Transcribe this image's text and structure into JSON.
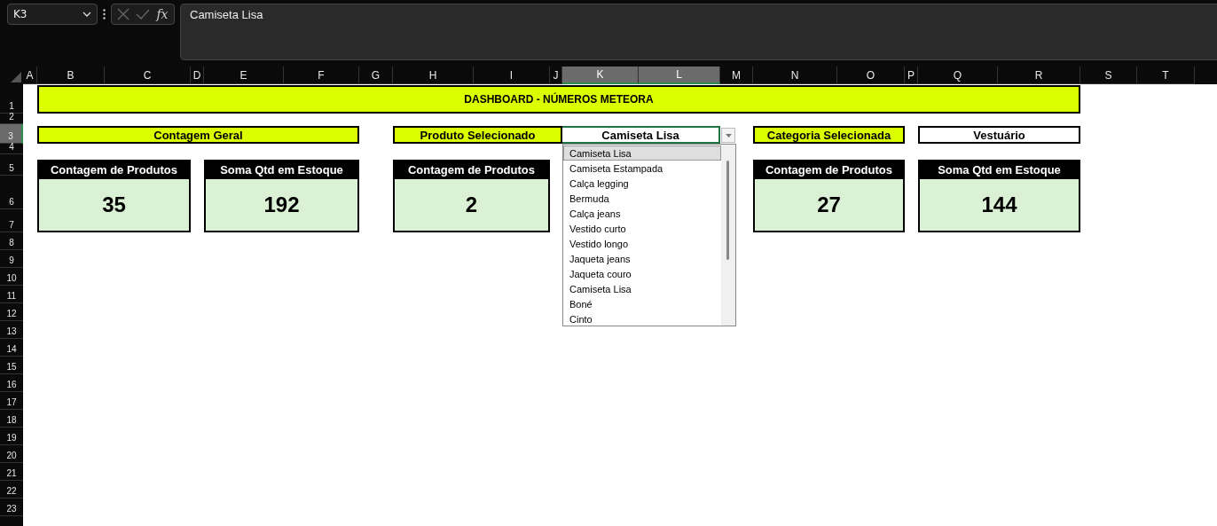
{
  "name_box": "K3",
  "function_label": "fx",
  "formula": "Camiseta Lisa",
  "columns": [
    {
      "label": "A",
      "selected": false
    },
    {
      "label": "B",
      "selected": false
    },
    {
      "label": "C",
      "selected": false
    },
    {
      "label": "D",
      "selected": false
    },
    {
      "label": "E",
      "selected": false
    },
    {
      "label": "F",
      "selected": false
    },
    {
      "label": "G",
      "selected": false
    },
    {
      "label": "H",
      "selected": false
    },
    {
      "label": "I",
      "selected": false
    },
    {
      "label": "J",
      "selected": false
    },
    {
      "label": "K",
      "selected": true
    },
    {
      "label": "L",
      "selected": true
    },
    {
      "label": "M",
      "selected": false
    },
    {
      "label": "N",
      "selected": false
    },
    {
      "label": "O",
      "selected": false
    },
    {
      "label": "P",
      "selected": false
    },
    {
      "label": "Q",
      "selected": false
    },
    {
      "label": "R",
      "selected": false
    },
    {
      "label": "S",
      "selected": false
    },
    {
      "label": "T",
      "selected": false
    }
  ],
  "rows": [
    {
      "label": "1",
      "selected": false
    },
    {
      "label": "2",
      "selected": false
    },
    {
      "label": "3",
      "selected": true
    },
    {
      "label": "4",
      "selected": false
    },
    {
      "label": "5",
      "selected": false
    },
    {
      "label": "6",
      "selected": false
    },
    {
      "label": "7",
      "selected": false
    },
    {
      "label": "8",
      "selected": false
    },
    {
      "label": "9",
      "selected": false
    },
    {
      "label": "10",
      "selected": false
    },
    {
      "label": "11",
      "selected": false
    },
    {
      "label": "12",
      "selected": false
    },
    {
      "label": "13",
      "selected": false
    },
    {
      "label": "14",
      "selected": false
    },
    {
      "label": "15",
      "selected": false
    },
    {
      "label": "16",
      "selected": false
    },
    {
      "label": "17",
      "selected": false
    },
    {
      "label": "18",
      "selected": false
    },
    {
      "label": "19",
      "selected": false
    },
    {
      "label": "20",
      "selected": false
    },
    {
      "label": "21",
      "selected": false
    },
    {
      "label": "22",
      "selected": false
    },
    {
      "label": "23",
      "selected": false
    }
  ],
  "title": "DASHBOARD - NÚMEROS METEORA",
  "general": {
    "label": "Contagem Geral",
    "cards": [
      {
        "label": "Contagem de Produtos",
        "value": "35"
      },
      {
        "label": "Soma Qtd em Estoque",
        "value": "192"
      }
    ]
  },
  "product": {
    "label": "Produto Selecionado",
    "value": "Camiseta Lisa",
    "cards": [
      {
        "label": "Contagem de Produtos",
        "value": "2"
      }
    ]
  },
  "category": {
    "label": "Categoria Selecionada",
    "value": "Vestuário",
    "cards": [
      {
        "label": "Contagem de Produtos",
        "value": "27"
      },
      {
        "label": "Soma Qtd em Estoque",
        "value": "144"
      }
    ]
  },
  "dropdown": {
    "items": [
      {
        "label": "Camiseta Lisa",
        "selected": true
      },
      {
        "label": "Camiseta Estampada",
        "selected": false
      },
      {
        "label": "Calça legging",
        "selected": false
      },
      {
        "label": "Bermuda",
        "selected": false
      },
      {
        "label": "Calça jeans",
        "selected": false
      },
      {
        "label": "Vestido curto",
        "selected": false
      },
      {
        "label": "Vestido longo",
        "selected": false
      },
      {
        "label": "Jaqueta jeans",
        "selected": false
      },
      {
        "label": "Jaqueta couro",
        "selected": false
      },
      {
        "label": "Camiseta Lisa",
        "selected": false
      },
      {
        "label": "Boné",
        "selected": false
      },
      {
        "label": "Cinto",
        "selected": false
      }
    ]
  }
}
